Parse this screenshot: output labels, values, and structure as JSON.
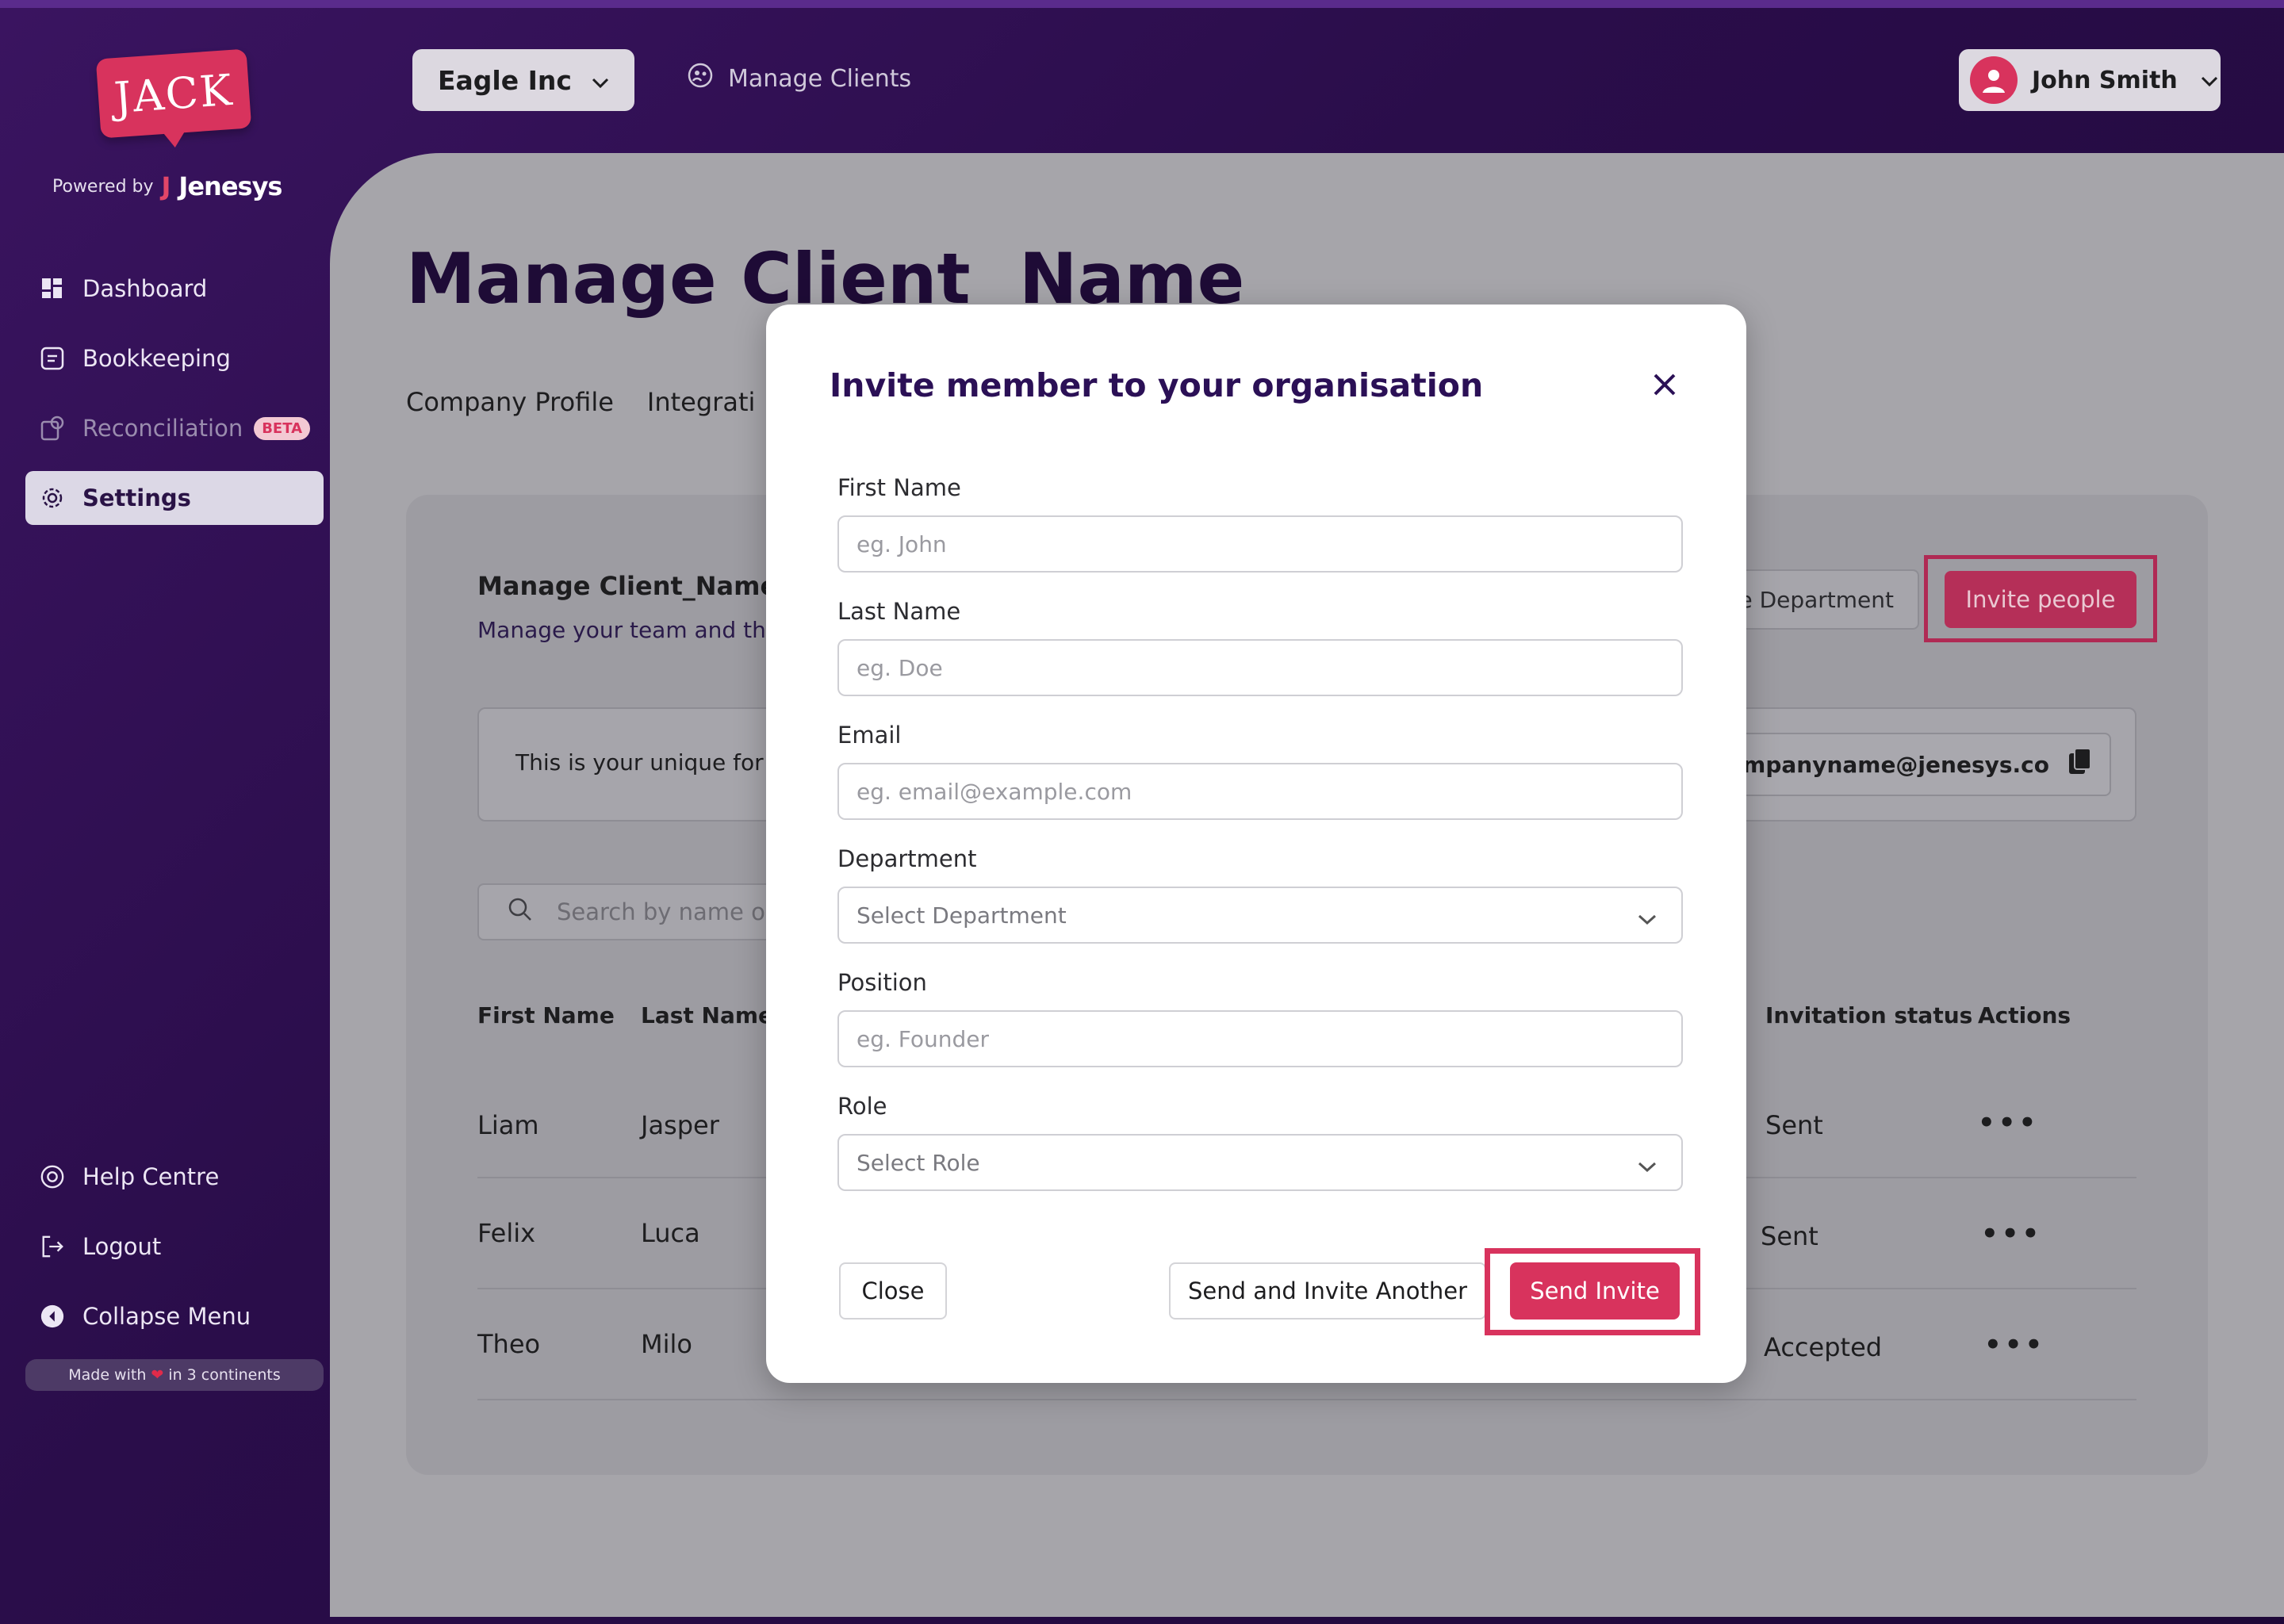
{
  "brand": {
    "logo_text": "JACK",
    "powered_by": "Powered by",
    "company": "Jenesys",
    "company_mark": "J"
  },
  "sidebar": {
    "items": [
      {
        "label": "Dashboard",
        "icon": "dashboard-icon"
      },
      {
        "label": "Bookkeeping",
        "icon": "book-icon"
      },
      {
        "label": "Reconciliation",
        "icon": "ai-reconcile-icon",
        "badge": "BETA"
      },
      {
        "label": "Settings",
        "icon": "gear-icon",
        "active": true
      }
    ],
    "footer_items": [
      {
        "label": "Help Centre",
        "icon": "lifebuoy-icon"
      },
      {
        "label": "Logout",
        "icon": "logout-icon"
      },
      {
        "label": "Collapse Menu",
        "icon": "collapse-icon"
      }
    ],
    "made_with_prefix": "Made with",
    "made_with_suffix": "in 3 continents"
  },
  "header": {
    "client_name": "Eagle Inc",
    "manage_clients": "Manage Clients",
    "user_name": "John Smith"
  },
  "main": {
    "title": "Manage Client  Name",
    "tabs": [
      "Company Profile",
      "Integrati"
    ],
    "section_title": "Manage Client_Name",
    "section_subtitle": "Manage your  team and th",
    "department_button": "e Department",
    "invite_button": "Invite people",
    "forward_text": "This is your unique for",
    "forward_email": "mpanyname@jenesys.co",
    "search_placeholder": "Search by name or",
    "table": {
      "headers": [
        "First Name",
        "Last Name",
        "Invitation status",
        "Actions"
      ],
      "rows": [
        {
          "first": "Liam",
          "last": "Jasper",
          "status": "Sent"
        },
        {
          "first": "Felix",
          "last": "Luca",
          "status": "Sent"
        },
        {
          "first": "Theo",
          "last": "Milo",
          "status": "Accepted"
        }
      ],
      "actions_glyph": "•••"
    }
  },
  "modal": {
    "title": "Invite member to your organisation",
    "fields": {
      "first_name": {
        "label": "First Name",
        "placeholder": "eg. John"
      },
      "last_name": {
        "label": "Last Name",
        "placeholder": "eg. Doe"
      },
      "email": {
        "label": "Email",
        "placeholder": "eg. email@example.com"
      },
      "department": {
        "label": "Department",
        "placeholder": "Select Department"
      },
      "position": {
        "label": "Position",
        "placeholder": "eg. Founder"
      },
      "role": {
        "label": "Role",
        "placeholder": "Select Role"
      }
    },
    "buttons": {
      "close": "Close",
      "send_another": "Send and Invite Another",
      "send": "Send Invite"
    }
  },
  "colors": {
    "accent": "#d8335d",
    "sidebar_bg": "#2a0d4a",
    "title": "#2b1056"
  }
}
